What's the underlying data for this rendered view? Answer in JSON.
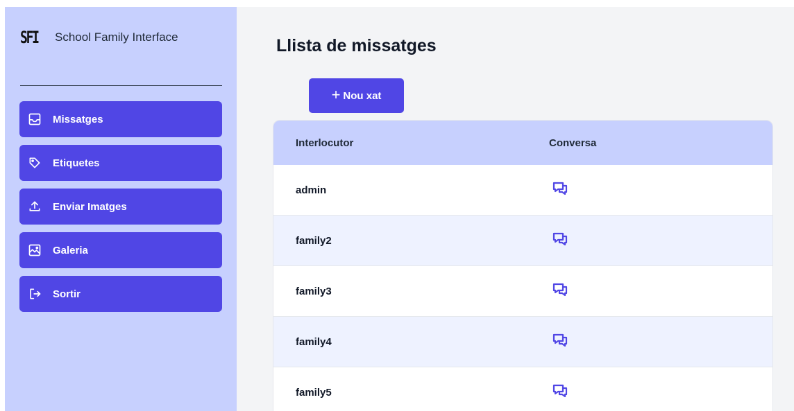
{
  "brand": {
    "logo": "SFI",
    "name": "School Family Interface"
  },
  "nav": {
    "items": [
      {
        "label": "Missatges",
        "icon": "inbox-icon"
      },
      {
        "label": "Etiquetes",
        "icon": "tag-icon"
      },
      {
        "label": "Enviar Imatges",
        "icon": "upload-icon"
      },
      {
        "label": "Galeria",
        "icon": "photo-icon"
      },
      {
        "label": "Sortir",
        "icon": "logout-icon"
      }
    ]
  },
  "main": {
    "title": "Llista de missatges",
    "new_chat": {
      "plus": "+",
      "label": "Nou xat"
    },
    "table": {
      "headers": [
        "Interlocutor",
        "Conversa"
      ],
      "rows": [
        "admin",
        "family2",
        "family3",
        "family4",
        "family5"
      ]
    }
  },
  "colors": {
    "sidebar_bg": "#c7d0fe",
    "accent": "#5046e5",
    "row_alt": "#eef2ff",
    "page_bg": "#f3f4f6"
  }
}
